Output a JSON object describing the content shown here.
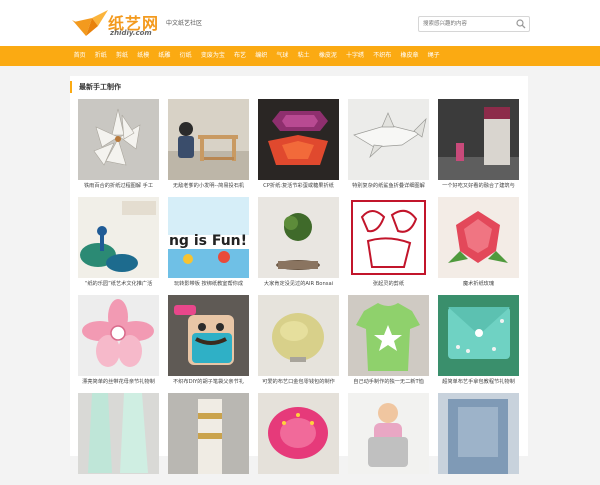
{
  "header": {
    "logo_cn": "纸艺网",
    "logo_en": "zhidiy.com",
    "slogan": "中文纸艺社区",
    "search_placeholder": "搜索感兴趣的内容",
    "accent_color": "#fbaa12"
  },
  "nav": {
    "items": [
      {
        "label": "首页"
      },
      {
        "label": "折纸"
      },
      {
        "label": "剪纸"
      },
      {
        "label": "纸模"
      },
      {
        "label": "纸雕"
      },
      {
        "label": "衍纸"
      },
      {
        "label": "变废为宝"
      },
      {
        "label": "布艺"
      },
      {
        "label": "编织"
      },
      {
        "label": "气球"
      },
      {
        "label": "粘土"
      },
      {
        "label": "橡皮泥"
      },
      {
        "label": "十字绣"
      },
      {
        "label": "不织布"
      },
      {
        "label": "橡皮章"
      },
      {
        "label": "绳子"
      }
    ]
  },
  "main": {
    "section_title": "最新手工制作",
    "items": [
      {
        "caption": "铁雨百合的折纸过程图解 手工"
      },
      {
        "caption": "无敌老爹的小发明--简易投石机"
      },
      {
        "caption": "CP折纸:复活节彩蛋或糖果折纸"
      },
      {
        "caption": "特别复杂的纸鲨鱼折叠详细图解"
      },
      {
        "caption": "一个好吃又好看的融合了建筑与"
      },
      {
        "caption": "“纸的乐园”纸艺术文化推广活"
      },
      {
        "caption": "玩转影带板 按绑纸教室帮你成"
      },
      {
        "caption": "大家肯定没见过的AIR Bonsai"
      },
      {
        "caption": "张起灵的剪纸"
      },
      {
        "caption": "魔术折纸玫瑰"
      },
      {
        "caption": "漂亮简单的丝带花母亲节礼物制"
      },
      {
        "caption": "不织布DIY的胡子笔袋父亲节礼"
      },
      {
        "caption": "可爱的布艺口金包零钱包的制作"
      },
      {
        "caption": "自己动手制作的独一无二新T恤"
      },
      {
        "caption": "超简单布艺手拿包教程节礼物制"
      },
      {
        "caption": ""
      },
      {
        "caption": ""
      },
      {
        "caption": ""
      },
      {
        "caption": ""
      },
      {
        "caption": ""
      }
    ]
  }
}
